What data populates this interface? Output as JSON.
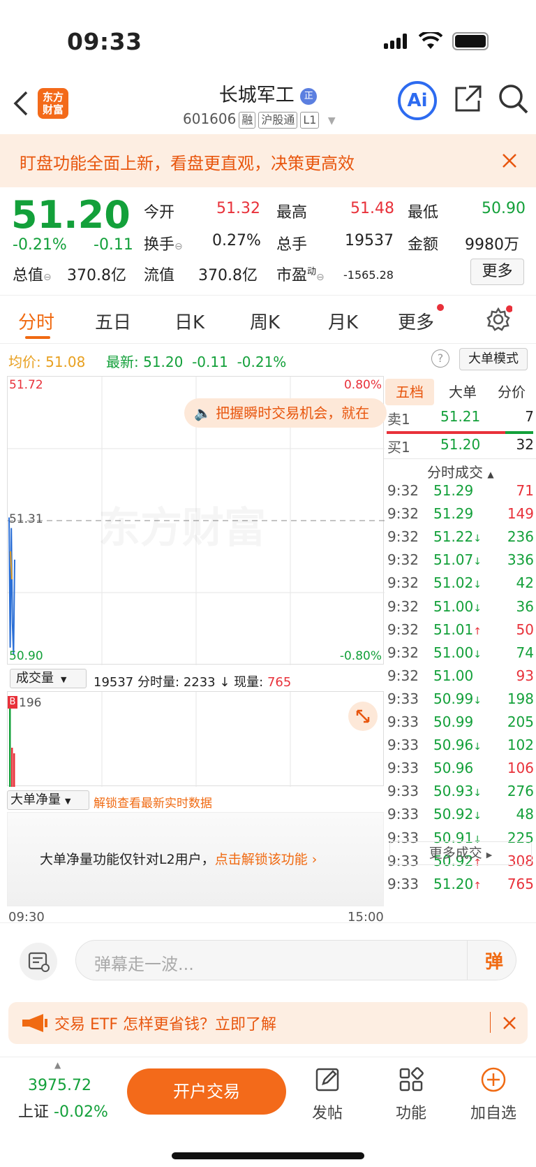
{
  "status_bar": {
    "time": "09:33"
  },
  "header": {
    "logo_text": "东方\n财富",
    "title": "长城军工",
    "title_badge": "正",
    "code": "601606",
    "tags": [
      "融",
      "沪股通",
      "L1"
    ],
    "ai_label": "Ai"
  },
  "banner": {
    "text": "盯盘功能全面上新，看盘更直观，决策更高效"
  },
  "quote": {
    "price": "51.20",
    "change_pct": "-0.21%",
    "change": "-0.11",
    "open_label": "今开",
    "open": "51.32",
    "high_label": "最高",
    "high": "51.48",
    "low_label": "最低",
    "low": "50.90",
    "turnover_label": "换手",
    "turnover": "0.27%",
    "volume_label": "总手",
    "volume": "19537",
    "amount_label": "金额",
    "amount": "9980万",
    "mktcap_label": "总值",
    "mktcap": "370.8亿",
    "float_label": "流值",
    "float": "370.8亿",
    "pe_label": "市盈",
    "pe_sup": "动",
    "pe": "-1565.28",
    "more_button": "更多"
  },
  "tabs": [
    "分时",
    "五日",
    "日K",
    "周K",
    "月K",
    "更多"
  ],
  "infoline": {
    "avg_label": "均价:",
    "avg": "51.08",
    "latest_label": "最新:",
    "latest": "51.20",
    "latest_change": "-0.11",
    "latest_pct": "-0.21%",
    "mode_button": "大单模式"
  },
  "chart": {
    "y_top": "51.72",
    "y_mid": "51.31",
    "y_bottom": "50.90",
    "pct_top": "0.80%",
    "pct_bottom": "-0.80%",
    "watermark": "东方财富",
    "promo": "把握瞬时交易机会，就在",
    "x_start": "09:30",
    "x_end": "15:00"
  },
  "chart_data": {
    "type": "line",
    "ylim": [
      50.9,
      51.72
    ],
    "series": [
      {
        "name": "",
        "values": [
          51.32,
          50.95,
          51.29,
          51.02,
          50.93,
          51.2
        ]
      }
    ]
  },
  "volume_bar": {
    "selector": "成交量",
    "total": "19537",
    "minute_label": "分时量:",
    "minute": "2233",
    "now_label": "现量:",
    "now": "765",
    "y_max": "196",
    "b_marker": "B"
  },
  "net_bar": {
    "selector": "大单净量",
    "unlock_link": "解锁查看最新实时数据",
    "lock_text": "大单净量功能仅针对L2用户，",
    "lock_link": "点击解锁该功能"
  },
  "right_panel": {
    "tabs": [
      "五档",
      "大单",
      "分价"
    ],
    "sell1_label": "卖1",
    "sell1_price": "51.21",
    "sell1_vol": "7",
    "buy1_label": "买1",
    "buy1_price": "51.20",
    "buy1_vol": "32",
    "trades_title": "分时成交",
    "trades": [
      {
        "t": "9:32",
        "p": "51.29",
        "a": "",
        "v": "71",
        "c": "red"
      },
      {
        "t": "9:32",
        "p": "51.29",
        "a": "",
        "v": "149",
        "c": "red"
      },
      {
        "t": "9:32",
        "p": "51.22",
        "a": "↓",
        "v": "236",
        "c": "green"
      },
      {
        "t": "9:32",
        "p": "51.07",
        "a": "↓",
        "v": "336",
        "c": "green"
      },
      {
        "t": "9:32",
        "p": "51.02",
        "a": "↓",
        "v": "42",
        "c": "green"
      },
      {
        "t": "9:32",
        "p": "51.00",
        "a": "↓",
        "v": "36",
        "c": "green"
      },
      {
        "t": "9:32",
        "p": "51.01",
        "a": "↑",
        "v": "50",
        "c": "red"
      },
      {
        "t": "9:32",
        "p": "51.00",
        "a": "↓",
        "v": "74",
        "c": "green"
      },
      {
        "t": "9:32",
        "p": "51.00",
        "a": "",
        "v": "93",
        "c": "red"
      },
      {
        "t": "9:33",
        "p": "50.99",
        "a": "↓",
        "v": "198",
        "c": "green"
      },
      {
        "t": "9:33",
        "p": "50.99",
        "a": "",
        "v": "205",
        "c": "green"
      },
      {
        "t": "9:33",
        "p": "50.96",
        "a": "↓",
        "v": "102",
        "c": "green"
      },
      {
        "t": "9:33",
        "p": "50.96",
        "a": "",
        "v": "106",
        "c": "red"
      },
      {
        "t": "9:33",
        "p": "50.93",
        "a": "↓",
        "v": "276",
        "c": "green"
      },
      {
        "t": "9:33",
        "p": "50.92",
        "a": "↓",
        "v": "48",
        "c": "green"
      },
      {
        "t": "9:33",
        "p": "50.91",
        "a": "↓",
        "v": "225",
        "c": "green"
      },
      {
        "t": "9:33",
        "p": "50.92",
        "a": "↑",
        "v": "308",
        "c": "red"
      },
      {
        "t": "9:33",
        "p": "51.20",
        "a": "↑",
        "v": "765",
        "c": "red"
      }
    ],
    "more_trades": "更多成交"
  },
  "comment": {
    "placeholder": "弹幕走一波...",
    "send": "弹"
  },
  "ad": {
    "text": "交易 ETF 怎样更省钱？立即了解"
  },
  "bottom": {
    "index_value": "3975.72",
    "index_name": "上证",
    "index_pct": "-0.02%",
    "open_button": "开户交易",
    "post_label": "发帖",
    "func_label": "功能",
    "fav_label": "加自选"
  },
  "colors": {
    "up": "#e8313a",
    "down": "#13a03a",
    "accent": "#f06a12"
  }
}
